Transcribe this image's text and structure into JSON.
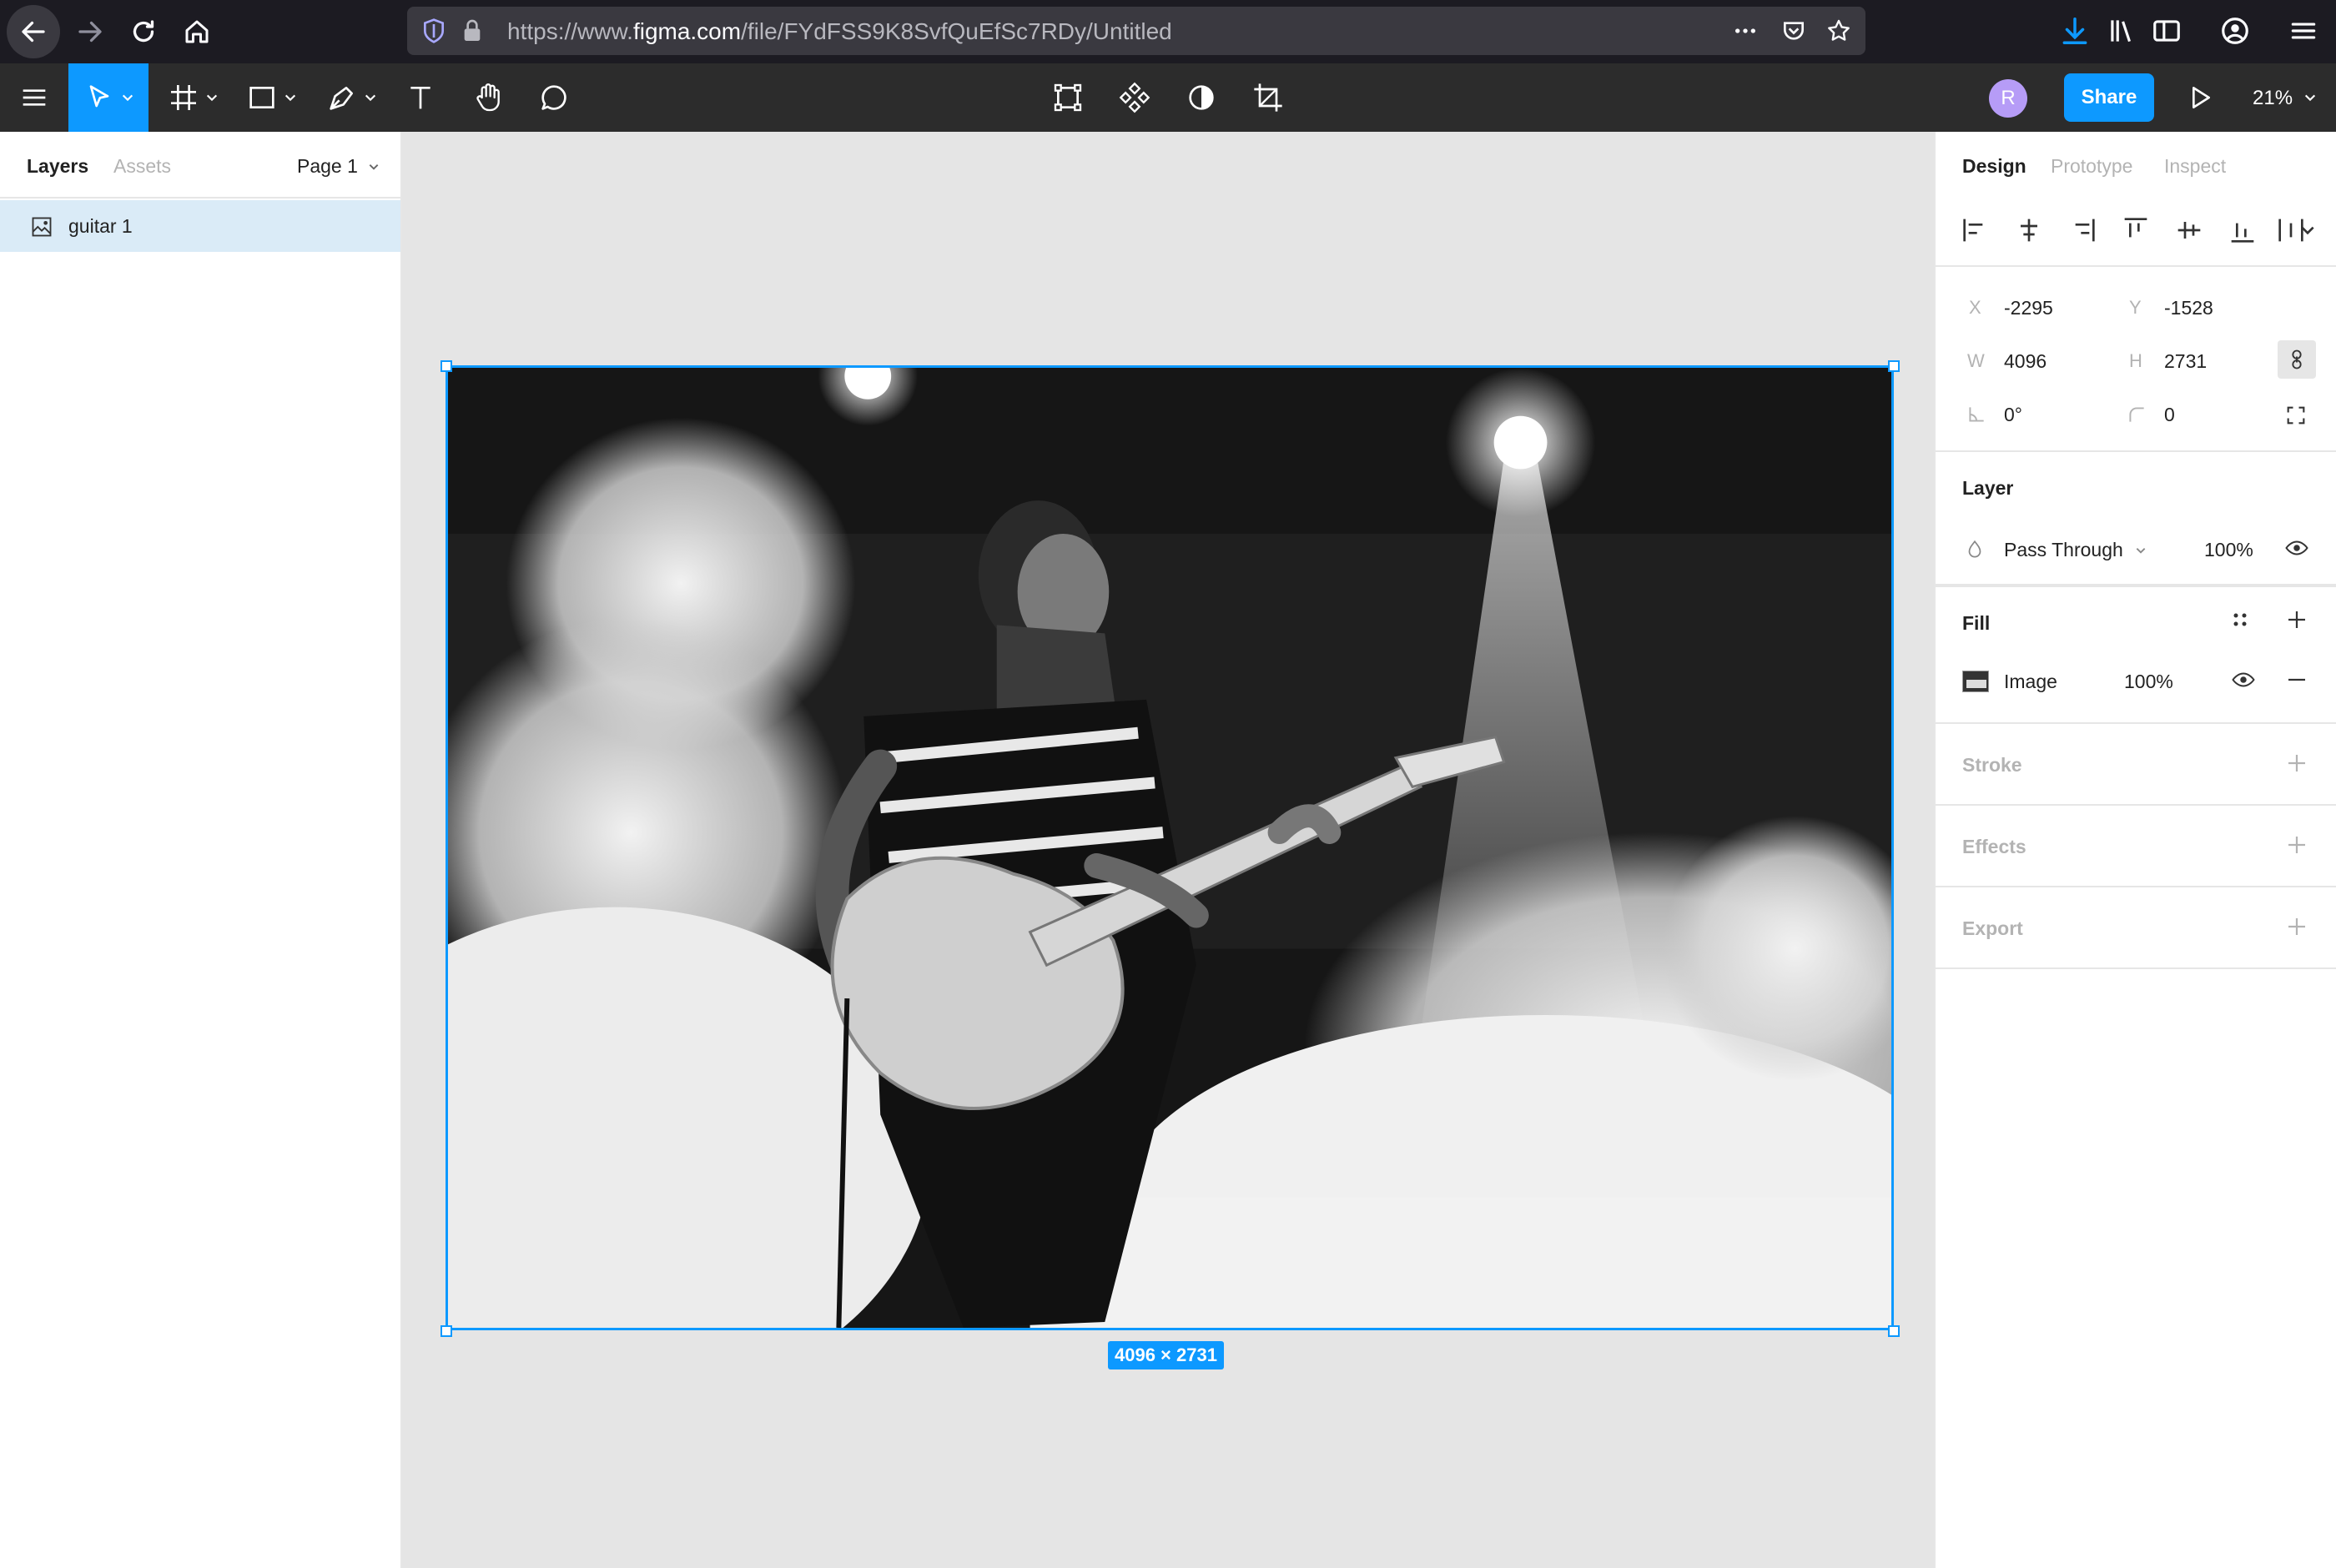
{
  "browser": {
    "url_prefix": "https://www.",
    "url_domain": "figma.com",
    "url_path": "/file/FYdFSS9K8SvfQuEfSc7RDy/Untitled"
  },
  "toolbar": {
    "share_label": "Share",
    "zoom_label": "21%",
    "avatar_initial": "R"
  },
  "layers_panel": {
    "tab_layers": "Layers",
    "tab_assets": "Assets",
    "page_label": "Page 1",
    "layers": [
      {
        "name": "guitar 1"
      }
    ]
  },
  "canvas": {
    "size_badge": "4096 × 2731",
    "help_label": "?"
  },
  "design_panel": {
    "tabs": [
      "Design",
      "Prototype",
      "Inspect"
    ],
    "x_label": "X",
    "x_value": "-2295",
    "y_label": "Y",
    "y_value": "-1528",
    "w_label": "W",
    "w_value": "4096",
    "h_label": "H",
    "h_value": "2731",
    "rotation_value": "0°",
    "radius_value": "0",
    "layer_title": "Layer",
    "blend_mode": "Pass Through",
    "layer_opacity": "100%",
    "fill_title": "Fill",
    "fill_type": "Image",
    "fill_opacity": "100%",
    "stroke_title": "Stroke",
    "effects_title": "Effects",
    "export_title": "Export"
  },
  "colors": {
    "accent": "#0d99ff",
    "toolbar_bg": "#2c2c2c",
    "browser_bg": "#1c1b22",
    "selected_row": "#daebf7",
    "avatar": "#b69cf7"
  }
}
